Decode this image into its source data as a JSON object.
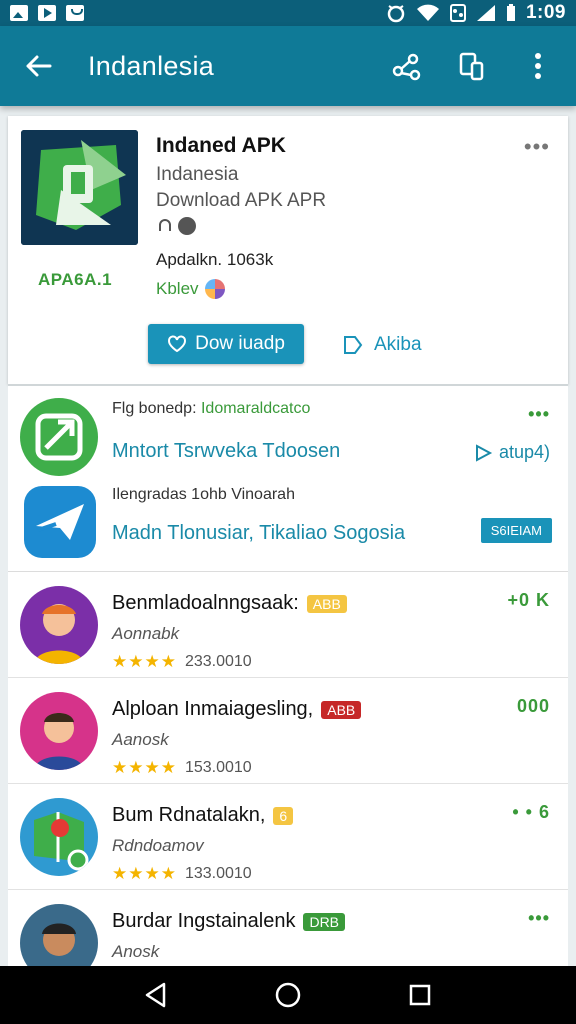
{
  "status_bar": {
    "time": "1:09"
  },
  "app_bar": {
    "title": "Indanlesia"
  },
  "card": {
    "app_name": "Indaned APK",
    "developer": "Indanesia",
    "download_line": "Download APK APR",
    "apk_label": "APA6A.1",
    "size": "Apdalkn. 1063k",
    "kb_label": "Kblev",
    "download_button": "Dow iuadp",
    "secondary_button": "Akiba",
    "more": "•••"
  },
  "list": [
    {
      "kind": "promo",
      "line1": "Flg bonedp:",
      "line1b": "Idomaraldcatco",
      "line2": "Mntort Tsrwveka Tdoosen",
      "action": "atup4)"
    },
    {
      "kind": "promo2",
      "line1": "Ilengradas",
      "line1b": "1ohb Vinoarah",
      "line2": "Madn Tlonusiar, Tikaliao Sogosia",
      "badge": "S6IEIAM"
    },
    {
      "kind": "app",
      "title": "Benmladoalnngsaak:",
      "badge": "ABB",
      "badge_color": "#f4c542",
      "sub": "Aonnabk",
      "stars": "★★★★",
      "count": "233.0010",
      "dots": "+0 K"
    },
    {
      "kind": "app",
      "title": "Alploan Inmaiagesling,",
      "badge": "ABB",
      "badge_color": "#c62828",
      "sub": "Aanosk",
      "stars": "★★★★",
      "count": "153.0010",
      "dots": "000"
    },
    {
      "kind": "app",
      "title": "Bum Rdnatalakn,",
      "badge": "6",
      "badge_color": "#f4c542",
      "sub": "Rdndoamov",
      "stars": "★★★★",
      "count": "133.0010",
      "dots": "• • 6"
    },
    {
      "kind": "app",
      "title": "Burdar Ingstainalenk",
      "badge": "DRB",
      "badge_color": "#3a9a3a",
      "sub": "Anosk",
      "stars": "",
      "count": "",
      "dots": "•••"
    }
  ]
}
